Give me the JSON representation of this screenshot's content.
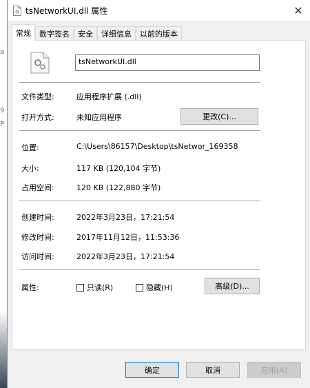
{
  "window": {
    "title": "tsNetworkUI.dll 属性"
  },
  "background_glyphs": [
    "a",
    "9",
    "P"
  ],
  "tabs": [
    {
      "label": "常规",
      "active": true
    },
    {
      "label": "数字签名",
      "active": false
    },
    {
      "label": "安全",
      "active": false
    },
    {
      "label": "详细信息",
      "active": false
    },
    {
      "label": "以前的版本",
      "active": false
    }
  ],
  "general": {
    "file_name": "tsNetworkUI.dll",
    "file_type_label": "文件类型:",
    "file_type_value": "应用程序扩展 (.dll)",
    "open_with_label": "打开方式:",
    "open_with_value": "未知应用程序",
    "change_button": "更改(C)...",
    "location_label": "位置:",
    "location_value": "C:\\Users\\86157\\Desktop\\tsNetwor_169358",
    "size_label": "大小:",
    "size_value": "117 KB (120,104 字节)",
    "size_on_disk_label": "占用空间:",
    "size_on_disk_value": "120 KB (122,880 字节)",
    "created_label": "创建时间:",
    "created_value": "2022年3月23日，17:21:54",
    "modified_label": "修改时间:",
    "modified_value": "2017年11月12日，11:53:36",
    "accessed_label": "访问时间:",
    "accessed_value": "2022年3月23日，17:21:54",
    "attributes_label": "属性:",
    "readonly_label": "只读(R)",
    "hidden_label": "隐藏(H)",
    "advanced_button": "高级(D)..."
  },
  "footer": {
    "ok": "确定",
    "cancel": "取消",
    "apply": "应用(A)"
  },
  "colors": {
    "accent": "#0078d7",
    "window_bg": "#f0f0f0",
    "panel_bg": "#ffffff"
  }
}
